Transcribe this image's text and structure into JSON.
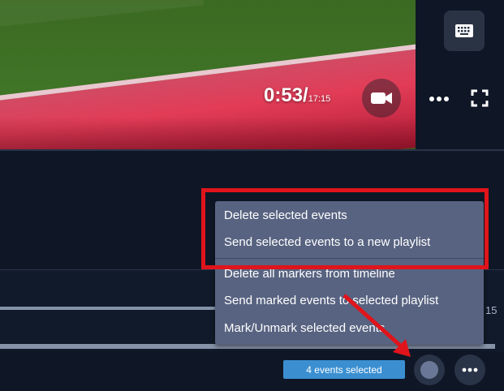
{
  "video": {
    "current_time": "0:53",
    "separator": "/",
    "total_time": "17:15"
  },
  "icons": {
    "keyboard": "keyboard-icon",
    "camera": "video-camera-icon",
    "more": "more-horizontal-icon",
    "fullscreen": "fullscreen-icon"
  },
  "timeline": {
    "partial_label": "15"
  },
  "context_menu": {
    "items": [
      "Delete selected events",
      "Send selected events to a new playlist",
      "Delete all markers from timeline",
      "Send marked events to selected playlist",
      "Mark/Unmark selected events"
    ]
  },
  "footer": {
    "events_selected": "4 events selected"
  },
  "colors": {
    "highlight": "#e0141b",
    "menu_bg": "#586381",
    "badge": "#3b8fd1"
  }
}
